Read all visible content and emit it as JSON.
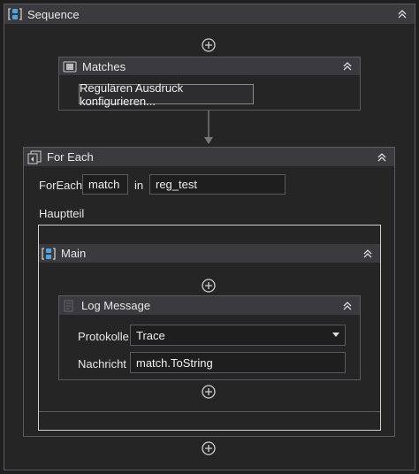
{
  "sequence": {
    "title": "Sequence",
    "icon": "sequence-icon"
  },
  "matches": {
    "title": "Matches",
    "button_label": "Regulären Ausdruck konfigurieren...",
    "icon": "regex-activity-icon"
  },
  "foreach": {
    "title": "For Each",
    "foreach_label": "ForEach",
    "item_value": "match",
    "in_label": "in",
    "collection_value": "reg_test",
    "body_label": "Hauptteil",
    "icon": "foreach-icon"
  },
  "main": {
    "title": "Main",
    "icon": "sequence-icon"
  },
  "log": {
    "title": "Log Message",
    "level_label": "Protokolle",
    "level_value": "Trace",
    "message_label": "Nachricht",
    "message_value": "match.ToString",
    "icon": "log-icon"
  },
  "colors": {
    "header": "#3a3a3f",
    "border": "#5a5a60",
    "accent": "#4fa3e0",
    "background": "#1f1f1f"
  }
}
